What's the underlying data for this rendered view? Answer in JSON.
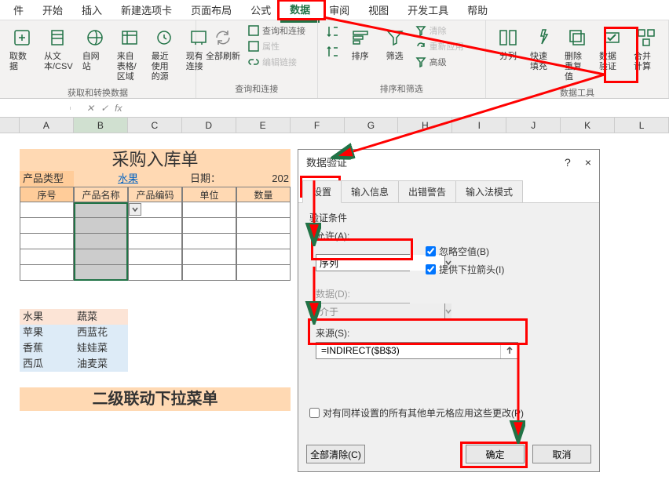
{
  "ribbon": {
    "tabs": [
      "件",
      "开始",
      "插入",
      "新建选项卡",
      "页面布局",
      "公式",
      "数据",
      "审阅",
      "视图",
      "开发工具",
      "帮助"
    ],
    "active_tab": "数据",
    "groups": {
      "get_transform": {
        "label": "获取和转换数据",
        "items": [
          "取数据",
          "从文本/CSV",
          "自网站",
          "来自表格/区域",
          "最近使用的源",
          "现有连接"
        ]
      },
      "queries": {
        "label": "查询和连接",
        "items": [
          "全部刷新",
          "查询和连接",
          "属性",
          "编辑链接"
        ]
      },
      "sort_filter": {
        "label": "排序和筛选",
        "items": [
          "排序",
          "筛选",
          "清除",
          "重新应用",
          "高级"
        ],
        "sort_az": "A↓Z",
        "sort_za": "Z↓A"
      },
      "data_tools": {
        "label": "数据工具",
        "items": [
          "分列",
          "快速填充",
          "删除重复值",
          "数据验证",
          "合并计算"
        ]
      }
    }
  },
  "formula_bar": {
    "fx": "fx"
  },
  "columns": [
    "A",
    "B",
    "C",
    "D",
    "E",
    "F",
    "G",
    "H",
    "I",
    "J",
    "K",
    "L"
  ],
  "sheet": {
    "title": "采购入库单",
    "header": {
      "type_label": "产品类型",
      "type_value": "水果",
      "date_label": "日期：",
      "date_value": "202"
    },
    "cols": [
      "序号",
      "产品名称",
      "产品编码",
      "单位",
      "数量"
    ],
    "ref": {
      "headers": [
        "水果",
        "蔬菜"
      ],
      "rows": [
        [
          "苹果",
          "西蓝花"
        ],
        [
          "香蕉",
          "娃娃菜"
        ],
        [
          "西瓜",
          "油麦菜"
        ]
      ]
    },
    "banner": "二级联动下拉菜单"
  },
  "dialog": {
    "title": "数据验证",
    "help": "?",
    "close": "×",
    "tabs": [
      "设置",
      "输入信息",
      "出错警告",
      "输入法模式"
    ],
    "section": "验证条件",
    "allow_label": "允许(A):",
    "allow_value": "序列",
    "ignore_blank": "忽略空值(B)",
    "dropdown": "提供下拉箭头(I)",
    "data_label": "数据(D):",
    "data_value": "介于",
    "source_label": "来源(S):",
    "source_value": "=INDIRECT($B$3)",
    "apply_others": "对有同样设置的所有其他单元格应用这些更改(P)",
    "clear_all": "全部清除(C)",
    "ok": "确定",
    "cancel": "取消"
  }
}
